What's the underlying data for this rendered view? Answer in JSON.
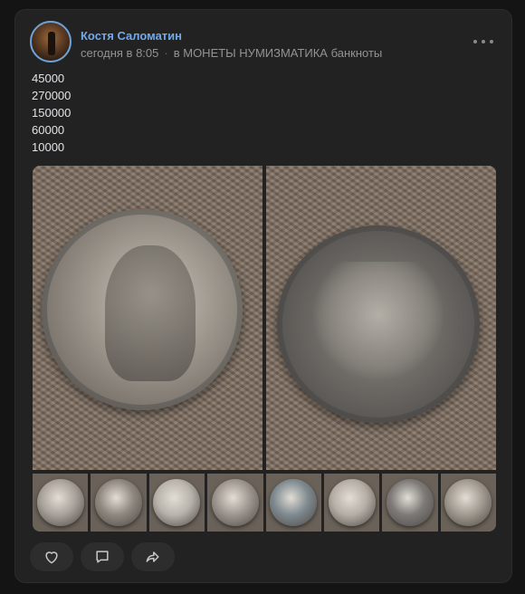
{
  "post": {
    "author": "Костя Саломатин",
    "time": "сегодня в 8:05",
    "separator": "·",
    "group": "в МОНЕТЫ НУМИЗМАТИКА банкноты",
    "text_lines": [
      "45000",
      "270000",
      "150000",
      "60000",
      "10000"
    ]
  },
  "icons": {
    "more": "more-dots-icon",
    "like": "heart-icon",
    "comment": "comment-icon",
    "share": "share-icon"
  },
  "colors": {
    "background": "#141414",
    "card": "#222222",
    "author_link": "#71aaeb",
    "meta_text": "#939393",
    "text": "#e1e3e6",
    "action_bg": "#2d2d2d"
  },
  "gallery": {
    "main_photos": [
      "coin-obverse-photo",
      "coin-reverse-photo"
    ],
    "thumbnails": [
      "#a8a29a",
      "#8f8880",
      "#b8b3ab",
      "#9c968e",
      "#7f8a90",
      "#b4aea5",
      "#7d7a78",
      "#a09a90"
    ]
  }
}
